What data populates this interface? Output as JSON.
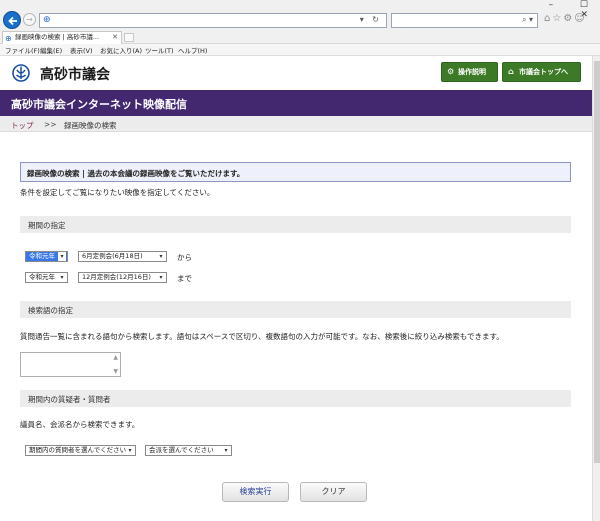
{
  "browser": {
    "tab_title": "録画映像の検索 | 高砂市議...",
    "address_controls": "▾ ↻",
    "search_controls": "⌕ ▾",
    "window_controls": "– ☐ ✕",
    "menu": [
      "ファイル(F)",
      "編集(E)",
      "表示(V)",
      "お気に入り(A)",
      "ツール(T)",
      "ヘルプ(H)"
    ]
  },
  "header": {
    "site_name": "高砂市議会",
    "help_button": "操作説明",
    "top_button": "市議会トップへ"
  },
  "banner": {
    "title": "高砂市議会インターネット映像配信"
  },
  "breadcrumb": {
    "home": "トップ",
    "separator": ">>",
    "current": "録画映像の検索"
  },
  "notice": "録画映像の検索 | 過去の本会議の録画映像をご覧いただけます。",
  "intro": "条件を設定してご覧になりたい映像を指定してください。",
  "period": {
    "heading": "期間の指定",
    "from": {
      "era": "令和元年",
      "session": "6月定例会(6月18日)",
      "suffix": "から"
    },
    "to": {
      "era": "令和元年",
      "session": "12月定例会(12月16日)",
      "suffix": "まで"
    }
  },
  "keyword": {
    "heading": "検索語の指定",
    "help": "質問通告一覧に含まれる語句から検索します。語句はスペースで区切り、複数語句の入力が可能です。なお、検索後に絞り込み検索もできます。",
    "value": ""
  },
  "speaker": {
    "heading": "期間内の質疑者・質問者",
    "help": "議員名、会派名から検索できます。",
    "member_select": "期間内の質問者を選んでください",
    "faction_select": "会派を選んでください"
  },
  "actions": {
    "search": "検索実行",
    "clear": "クリア"
  },
  "colors": {
    "banner": "#432870",
    "green_button": "#3d7a27",
    "breadcrumb_link": "#7a1f52"
  }
}
